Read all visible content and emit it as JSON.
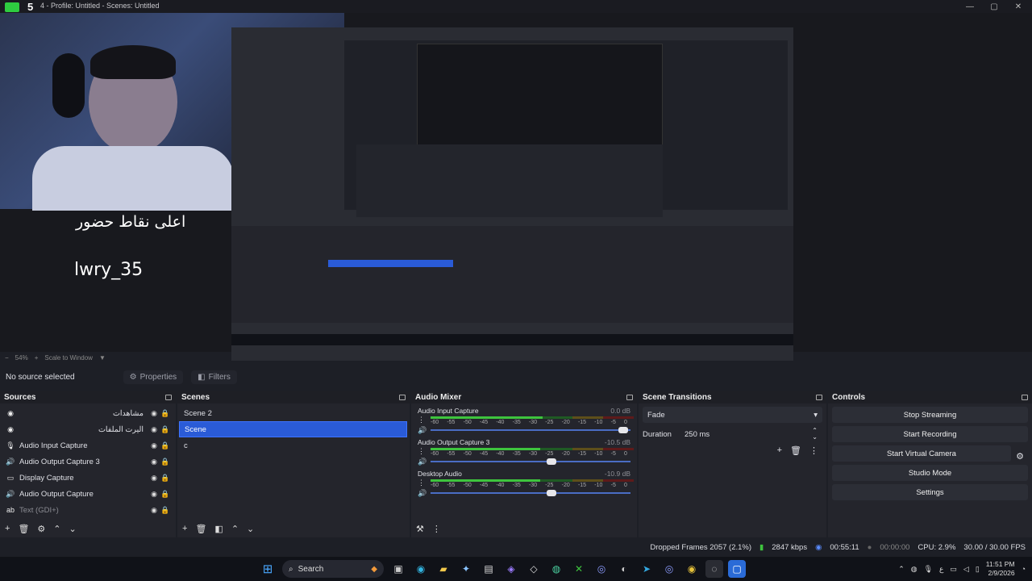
{
  "window": {
    "title": "4 - Profile: Untitled - Scenes: Untitled",
    "stream_number": "5",
    "controls": {
      "minimize": "—",
      "maximize": "▢",
      "close": "✕"
    }
  },
  "preview": {
    "overlay_title": "اعلى نقاط حضور",
    "overlay_user": "lwry_35",
    "zoom": "54%",
    "scale_mode": "Scale to Window"
  },
  "context_bar": {
    "no_source": "No source selected",
    "properties": "Properties",
    "filters": "Filters"
  },
  "sources": {
    "title": "Sources",
    "items": [
      {
        "label": "مشاهدات",
        "icon": "browser",
        "rtl": true,
        "dim": false
      },
      {
        "label": "اليرت الملفات",
        "icon": "browser",
        "rtl": true,
        "dim": false
      },
      {
        "label": "Audio Input Capture",
        "icon": "mic",
        "rtl": false,
        "dim": false
      },
      {
        "label": "Audio Output Capture 3",
        "icon": "speaker",
        "rtl": false,
        "dim": false
      },
      {
        "label": "Display Capture",
        "icon": "monitor",
        "rtl": false,
        "dim": false
      },
      {
        "label": "Audio Output Capture",
        "icon": "speaker",
        "rtl": false,
        "dim": false
      },
      {
        "label": "Text (GDI+)",
        "icon": "text",
        "rtl": false,
        "dim": true
      }
    ]
  },
  "scenes": {
    "title": "Scenes",
    "items": [
      "Scene 2",
      "Scene",
      "c"
    ],
    "selected_index": 1
  },
  "audio_mixer": {
    "title": "Audio Mixer",
    "ticks": [
      "-60",
      "-55",
      "-50",
      "-45",
      "-40",
      "-35",
      "-30",
      "-25",
      "-20",
      "-15",
      "-10",
      "-5",
      "0"
    ],
    "channels": [
      {
        "name": "Audio Input Capture",
        "db": "0.0 dB",
        "level": 0.55,
        "fader": 0.97
      },
      {
        "name": "Audio Output Capture 3",
        "db": "-10.5 dB",
        "level": 0.54,
        "fader": 0.6
      },
      {
        "name": "Desktop Audio",
        "db": "-10.9 dB",
        "level": 0.54,
        "fader": 0.6
      }
    ]
  },
  "scene_transitions": {
    "title": "Scene Transitions",
    "transition": "Fade",
    "duration_label": "Duration",
    "duration_value": "250 ms"
  },
  "controls": {
    "title": "Controls",
    "buttons": [
      "Stop Streaming",
      "Start Recording",
      "Start Virtual Camera",
      "Studio Mode",
      "Settings"
    ]
  },
  "status": {
    "dropped_frames": "Dropped Frames 2057 (2.1%)",
    "bitrate": "2847 kbps",
    "stream_time": "00:55:11",
    "record_time": "00:00:00",
    "cpu": "CPU: 2.9%",
    "fps": "30.00 / 30.00 FPS"
  },
  "taskbar": {
    "search_label": "Search",
    "time": "11:51 PM",
    "date": "2/9/2026"
  },
  "colors": {
    "accent": "#2a5bd7",
    "meter_green": "#3ec43e",
    "meter_yellow": "#b59a2a",
    "meter_red": "#b82a2a"
  }
}
